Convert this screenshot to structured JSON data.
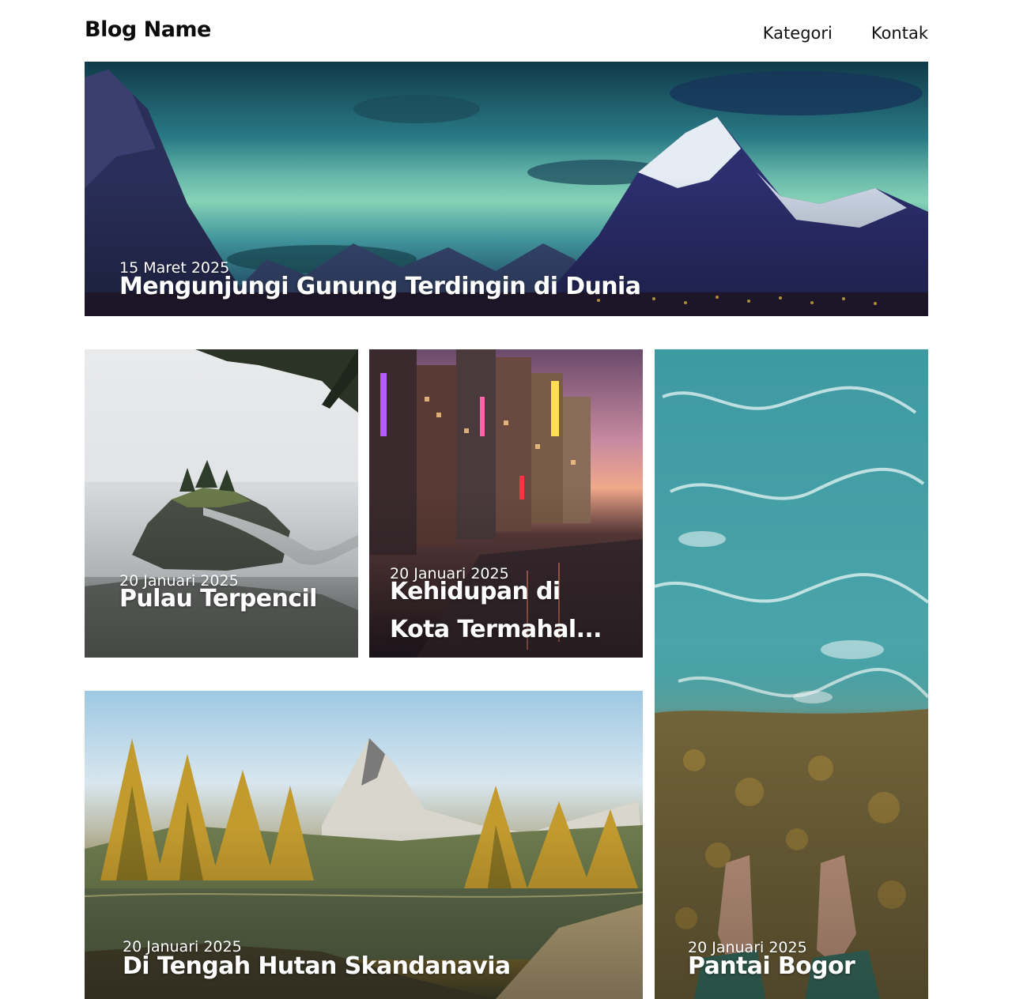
{
  "header": {
    "brand": "Blog Name",
    "nav": [
      {
        "label": "Kategori"
      },
      {
        "label": "Kontak"
      }
    ]
  },
  "posts": [
    {
      "date": "15 Maret 2025",
      "title": "Mengunjungi Gunung Terdingin di Dunia",
      "image": "snowy-mountains-sunset"
    },
    {
      "date": "20 Januari 2025",
      "title": "Pulau Terpencil",
      "image": "foggy-island"
    },
    {
      "date": "20 Januari 2025",
      "title": "Kehidupan di Kota Termahal...",
      "image": "city-canal-night"
    },
    {
      "date": "20 Januari 2025",
      "title": "Pantai  Bogor",
      "image": "sea-waves-feet"
    },
    {
      "date": "20 Januari 2025",
      "title": "Di Tengah Hutan Skandanavia",
      "image": "autumn-forest-lake"
    }
  ]
}
